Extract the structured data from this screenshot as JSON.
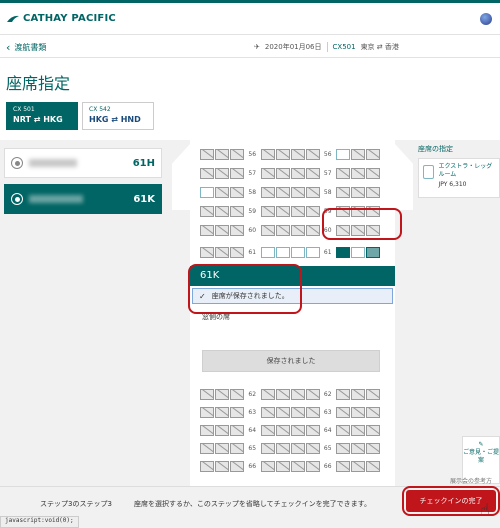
{
  "header": {
    "brand": "CATHAY PACIFIC",
    "globe_icon": "globe-icon"
  },
  "subbar": {
    "back_label": "渡航書類",
    "date": "2020年01月06日",
    "flight_no": "CX501",
    "route": "東京 ⇄ 香港"
  },
  "page": {
    "title": "座席指定"
  },
  "segments": [
    {
      "no": "CX 501",
      "route": "NRT ⇄ HKG",
      "active": true
    },
    {
      "no": "CX 542",
      "route": "HKG ⇄ HND",
      "active": false
    }
  ],
  "passengers": [
    {
      "seat": "61H",
      "active": false
    },
    {
      "seat": "61K",
      "active": true
    }
  ],
  "seatmap": {
    "rows_top": [
      "56",
      "57",
      "58",
      "59",
      "60",
      "61"
    ],
    "rows_bottom": [
      "62",
      "63",
      "64",
      "65",
      "66"
    ]
  },
  "popup": {
    "seat": "61K",
    "saved_msg": "座席が保存されました。",
    "seat_type": "窓側の席",
    "button": "保存されました"
  },
  "legend": {
    "label": "座席の指定",
    "item_name": "エクストラ・レッグルーム",
    "price": "JPY 6,310"
  },
  "feedback": {
    "label": "ご意見・ご提案",
    "sub": "展示会の参考方"
  },
  "footer": {
    "step": "ステップ3のステップ3",
    "message": "座席を選択するか、このステップを省略してチェックインを完了できます。",
    "checkin_button": "チェックインの完了"
  },
  "statusbar": "javascript:void(0);",
  "colors": {
    "brand": "#006564",
    "accent_red": "#c0151b"
  }
}
